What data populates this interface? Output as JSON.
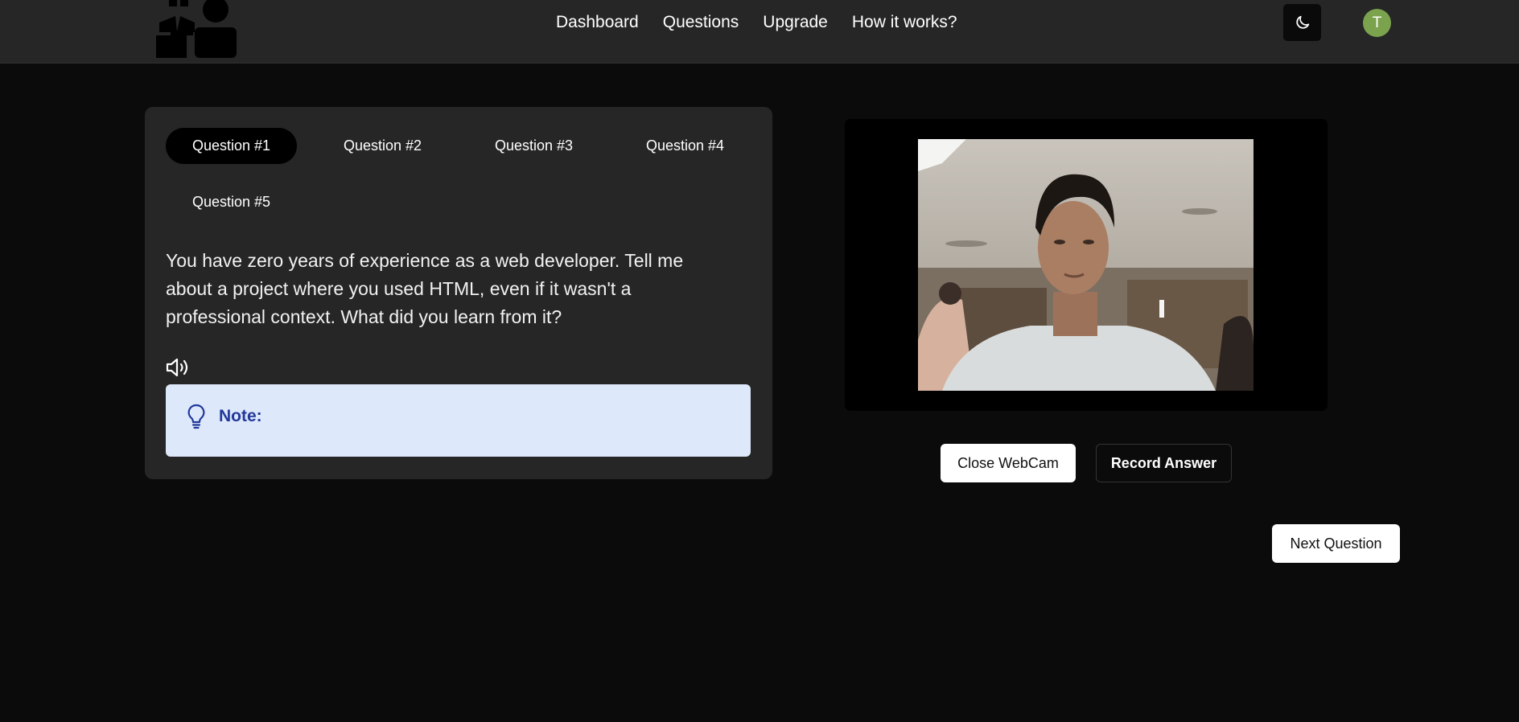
{
  "header": {
    "nav": [
      "Dashboard",
      "Questions",
      "Upgrade",
      "How it works?"
    ],
    "avatar_initial": "T"
  },
  "questions": {
    "tabs": [
      "Question #1",
      "Question #2",
      "Question #3",
      "Question #4",
      "Question #5"
    ],
    "active_index": 0,
    "current_text": "You have zero years of experience as a web developer. Tell me about a project where you used HTML, even if it wasn't a professional context. What did you learn from it?",
    "note_label": "Note:"
  },
  "webcam": {
    "close_label": "Close WebCam",
    "record_label": "Record Answer"
  },
  "footer": {
    "next_label": "Next Question"
  },
  "colors": {
    "page_bg": "#0b0b0b",
    "card_bg": "#262626",
    "note_bg": "#dde8fa",
    "note_text": "#23399a",
    "avatar_bg": "#7ba34d"
  }
}
